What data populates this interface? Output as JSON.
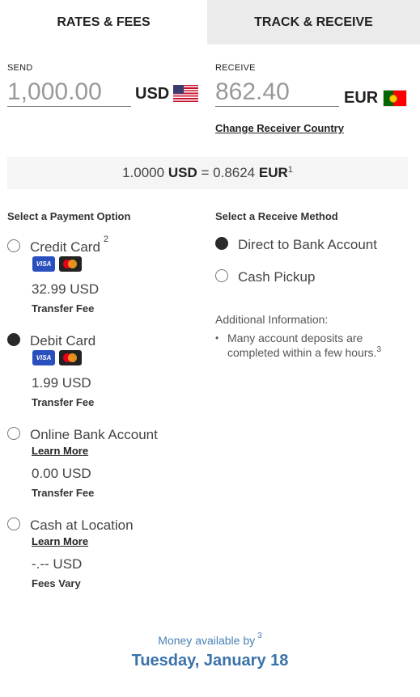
{
  "tabs": {
    "rates": "RATES & FEES",
    "track": "TRACK & RECEIVE"
  },
  "send": {
    "label": "SEND",
    "amount": "1,000.00",
    "currency": "USD"
  },
  "receive": {
    "label": "RECEIVE",
    "amount": "862.40",
    "currency": "EUR",
    "change_country": "Change Receiver Country"
  },
  "rate": {
    "lhs_value": "1.0000",
    "lhs_currency": "USD",
    "equals": "=",
    "rhs_value": "0.8624",
    "rhs_currency": "EUR",
    "footnote": "1"
  },
  "payment": {
    "title": "Select a Payment Option",
    "options": [
      {
        "label": "Credit Card",
        "footnote": "2",
        "fee": "32.99 USD",
        "fee_note": "Transfer Fee",
        "selected": false
      },
      {
        "label": "Debit Card",
        "fee": "1.99 USD",
        "fee_note": "Transfer Fee",
        "selected": true
      },
      {
        "label": "Online Bank Account",
        "link": "Learn More",
        "fee": "0.00 USD",
        "fee_note": "Transfer Fee",
        "selected": false
      },
      {
        "label": "Cash at Location",
        "link": "Learn More",
        "fee": "-.-- USD",
        "fee_note": "Fees Vary",
        "selected": false
      }
    ],
    "card_icons": {
      "visa": "VISA",
      "mastercard": "mastercard-icon"
    }
  },
  "receive_method": {
    "title": "Select a Receive Method",
    "options": [
      {
        "label": "Direct to Bank Account",
        "selected": true
      },
      {
        "label": "Cash Pickup",
        "selected": false
      }
    ],
    "additional_title": "Additional Information:",
    "additional_items": [
      {
        "text": "Many account deposits are completed within a few hours.",
        "footnote": "3"
      }
    ]
  },
  "availability": {
    "label": "Money available by",
    "footnote": "3",
    "date": "Tuesday, January 18"
  },
  "colors": {
    "accent": "#3a72aa",
    "tab_inactive": "#ebebeb",
    "rate_bar": "#f5f5f5"
  }
}
